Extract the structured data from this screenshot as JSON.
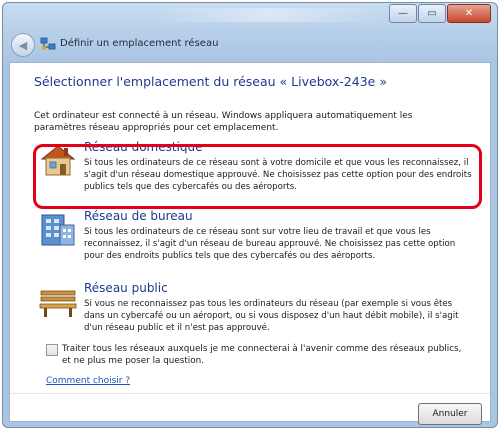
{
  "window": {
    "nav_title": "Définir un emplacement réseau",
    "controls": {
      "minimize": "—",
      "maximize": "▭",
      "close": "✕"
    },
    "back_icon": "back-arrow-icon"
  },
  "content": {
    "heading": "Sélectionner l'emplacement du réseau « Livebox-243e »",
    "intro": "Cet ordinateur est connecté à un réseau. Windows appliquera automatiquement les paramètres réseau appropriés pour cet emplacement.",
    "options": [
      {
        "title": "Réseau domestique",
        "icon": "house-icon",
        "description": "Si tous les ordinateurs de ce réseau sont à votre domicile et que vous les reconnaissez, il s'agit d'un réseau domestique approuvé. Ne choisissez pas cette option pour des endroits publics tels que des cybercafés ou des aéroports."
      },
      {
        "title": "Réseau de bureau",
        "icon": "office-building-icon",
        "description": "Si tous les ordinateurs de ce réseau sont sur votre lieu de travail et que vous les reconnaissez, il s'agit d'un réseau de bureau approuvé. Ne choisissez pas cette option pour des endroits publics tels que des cybercafés ou des aéroports."
      },
      {
        "title": "Réseau public",
        "icon": "park-bench-icon",
        "description": "Si vous ne reconnaissez pas tous les ordinateurs du réseau (par exemple si vous êtes dans un cybercafé ou un aéroport, ou si vous disposez d'un haut débit mobile), il s'agit d'un réseau public et il n'est pas approuvé."
      }
    ],
    "checkbox_label": "Traiter tous les réseaux auxquels je me connecterai à l'avenir comme des réseaux publics, et ne plus me poser la question.",
    "checkbox_checked": false,
    "help_link": "Comment choisir ?",
    "cancel_label": "Annuler"
  },
  "colors": {
    "highlight": "#e3001b",
    "heading": "#1e3a8c",
    "link": "#1a55c7"
  }
}
